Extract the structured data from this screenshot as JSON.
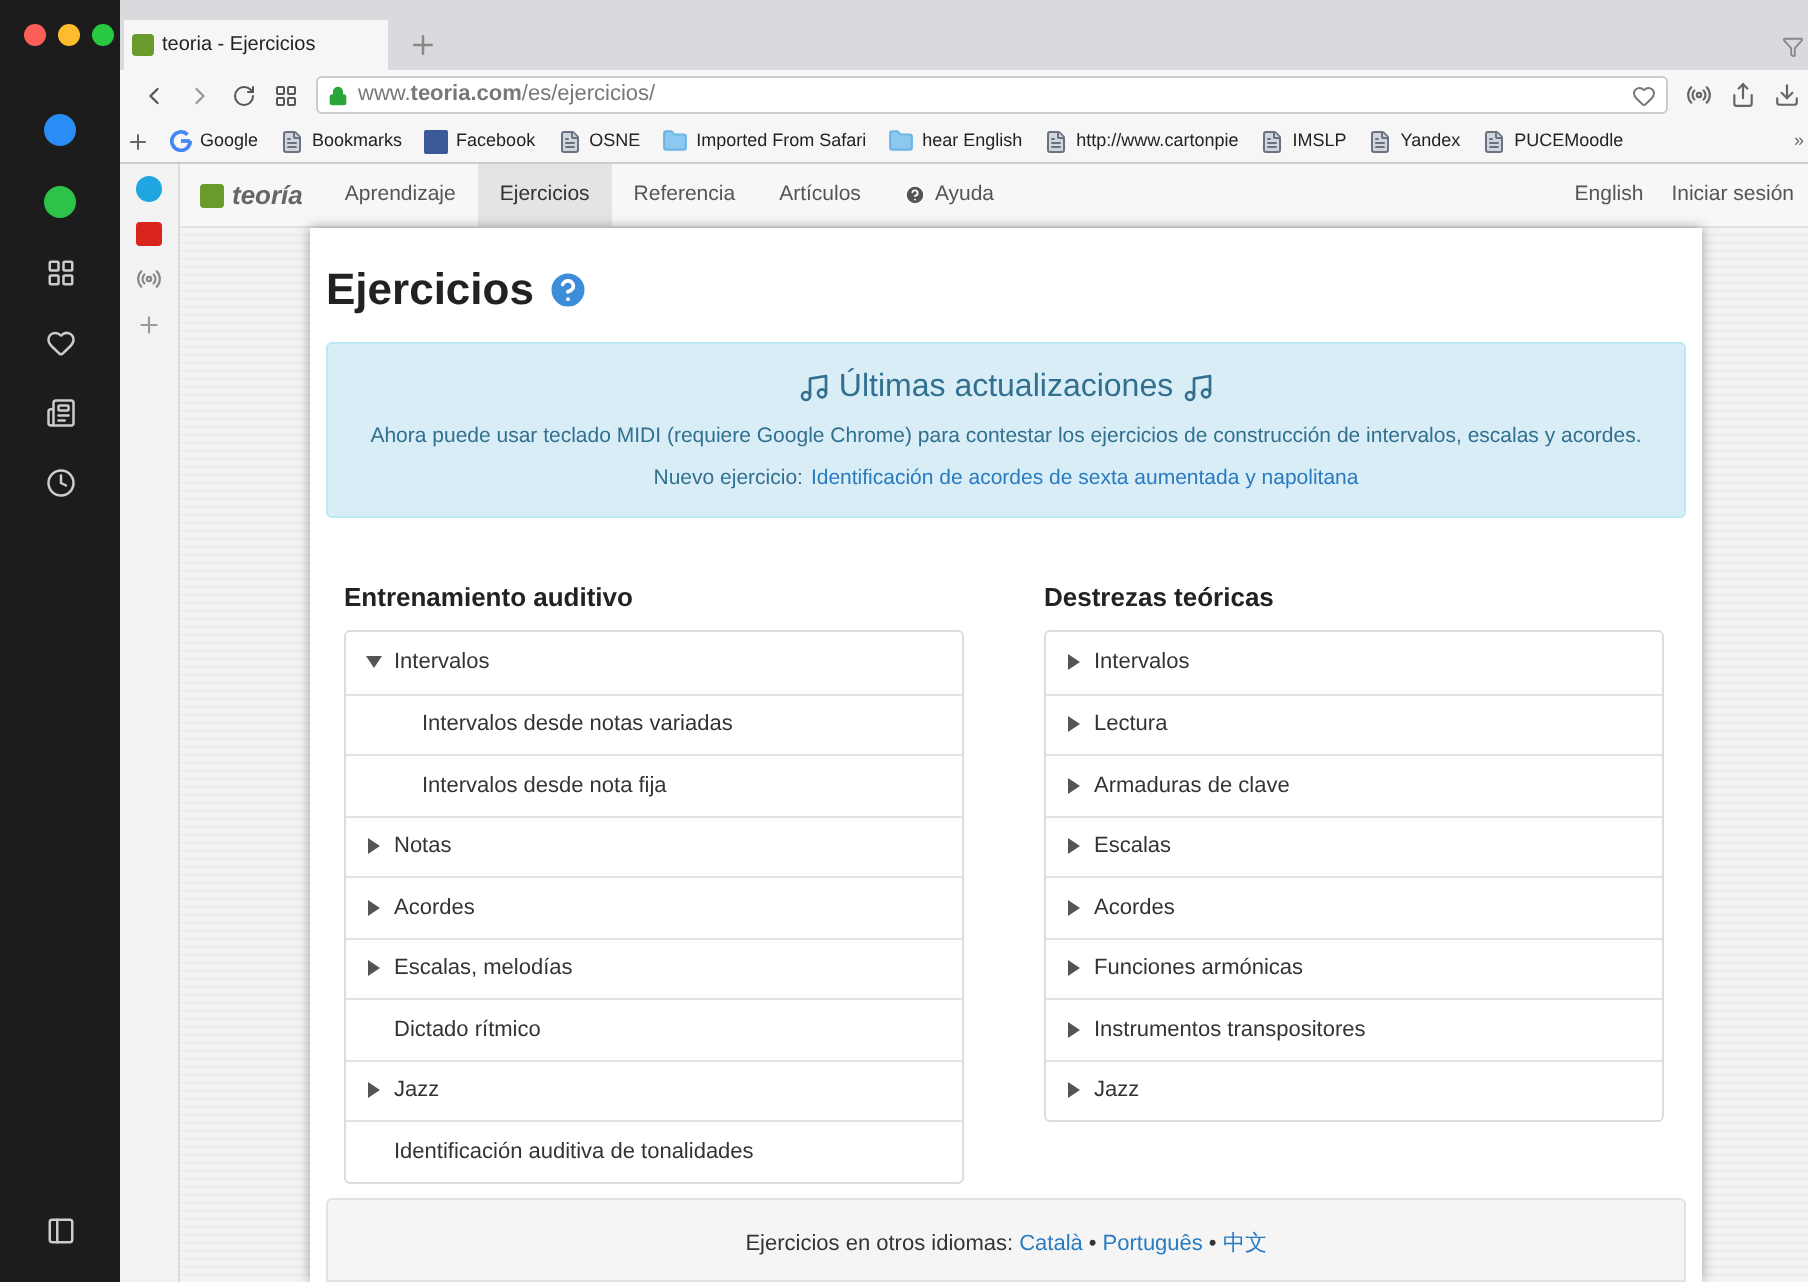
{
  "browser": {
    "tab_title": "teoria - Ejercicios",
    "address": {
      "prefix": "www.",
      "host": "teoria.com",
      "path": "/es/ejercicios/"
    },
    "bookmarks": [
      {
        "label": "Google",
        "kind": "google"
      },
      {
        "label": "Bookmarks",
        "kind": "page"
      },
      {
        "label": "Facebook",
        "kind": "facebook"
      },
      {
        "label": "OSNE",
        "kind": "page"
      },
      {
        "label": "Imported From Safari",
        "kind": "folder"
      },
      {
        "label": "hear English",
        "kind": "folder"
      },
      {
        "label": "http://www.cartonpie",
        "kind": "page"
      },
      {
        "label": "IMSLP",
        "kind": "page"
      },
      {
        "label": "Yandex",
        "kind": "page"
      },
      {
        "label": "PUCEMoodle",
        "kind": "page"
      }
    ],
    "bookmarks_more": "»"
  },
  "site_nav": {
    "logo": "teoría",
    "items": [
      {
        "label": "Aprendizaje",
        "selected": false
      },
      {
        "label": "Ejercicios",
        "selected": true
      },
      {
        "label": "Referencia",
        "selected": false
      },
      {
        "label": "Artículos",
        "selected": false
      },
      {
        "label": "Ayuda",
        "selected": false
      }
    ],
    "right": [
      "English",
      "Iniciar sesión"
    ]
  },
  "page": {
    "title": "Ejercicios",
    "news": {
      "title": "Últimas actualizaciones",
      "body": "Ahora puede usar teclado MIDI (requiere Google Chrome) para contestar los ejercicios de construcción de intervalos, escalas y acordes.",
      "new_prefix": "Nuevo ejercicio:",
      "new_link": "Identificación de acordes de sexta aumentada y napolitana"
    },
    "sections": [
      {
        "title": "Entrenamiento auditivo",
        "items": [
          {
            "label": "Intervalos",
            "kind": "group",
            "expanded": true,
            "children": [
              {
                "label": "Intervalos desde notas variadas"
              },
              {
                "label": "Intervalos desde nota fija"
              }
            ]
          },
          {
            "label": "Notas",
            "kind": "group",
            "expanded": false
          },
          {
            "label": "Acordes",
            "kind": "group",
            "expanded": false
          },
          {
            "label": "Escalas, melodías",
            "kind": "group",
            "expanded": false
          },
          {
            "label": "Dictado rítmico",
            "kind": "leaf"
          },
          {
            "label": "Jazz",
            "kind": "group",
            "expanded": false
          },
          {
            "label": "Identificación auditiva de tonalidades",
            "kind": "leaf"
          }
        ]
      },
      {
        "title": "Destrezas teóricas",
        "items": [
          {
            "label": "Intervalos",
            "kind": "group",
            "expanded": false
          },
          {
            "label": "Lectura",
            "kind": "group",
            "expanded": false
          },
          {
            "label": "Armaduras de clave",
            "kind": "group",
            "expanded": false
          },
          {
            "label": "Escalas",
            "kind": "group",
            "expanded": false
          },
          {
            "label": "Acordes",
            "kind": "group",
            "expanded": false
          },
          {
            "label": "Funciones armónicas",
            "kind": "group",
            "expanded": false
          },
          {
            "label": "Instrumentos transpositores",
            "kind": "group",
            "expanded": false
          },
          {
            "label": "Jazz",
            "kind": "group",
            "expanded": false
          }
        ]
      }
    ],
    "footer": {
      "prefix": "Ejercicios en otros idiomas:",
      "separator": "•",
      "links": [
        "Català",
        "Português",
        "中文"
      ]
    }
  }
}
